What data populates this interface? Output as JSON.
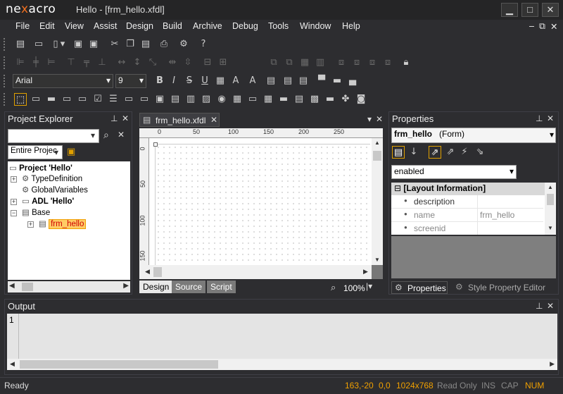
{
  "app": {
    "logo_a": "ne",
    "logo_x": "x",
    "logo_b": "acro",
    "window_title": "Hello - [frm_hello.xfdl]",
    "min": "▁",
    "max": "□",
    "close": "✕"
  },
  "menu": [
    "File",
    "Edit",
    "View",
    "Assist",
    "Design",
    "Build",
    "Archive",
    "Debug",
    "Tools",
    "Window",
    "Help"
  ],
  "mdi_controls": {
    "min": "–",
    "restore": "⧉",
    "close": "✕"
  },
  "font": {
    "family": "Arial",
    "size": "9"
  },
  "format_buttons": {
    "bold": "B",
    "italic": "I",
    "strike": "S",
    "underline": "U"
  },
  "project_explorer": {
    "title": "Project Explorer",
    "search_value": "",
    "scope": "Entire Projec",
    "tree": [
      {
        "label": "Project 'Hello'",
        "bold": true
      },
      {
        "label": "TypeDefinition"
      },
      {
        "label": "GlobalVariables"
      },
      {
        "label": "ADL 'Hello'",
        "bold": true
      },
      {
        "label": "Base"
      },
      {
        "label": "frm_hello",
        "selected": true
      }
    ]
  },
  "editor": {
    "tab": "frm_hello.xfdl",
    "ruler_h": [
      "0",
      "50",
      "100",
      "150",
      "200",
      "250"
    ],
    "ruler_v": [
      "0",
      "50",
      "100",
      "150"
    ],
    "bottom_tabs": [
      "Design",
      "Source",
      "Script"
    ],
    "zoom": "100%"
  },
  "properties": {
    "title": "Properties",
    "object_name": "frm_hello",
    "object_type": "(Form)",
    "filter": "enabled",
    "section": "[Layout Information]",
    "rows": [
      {
        "name": "description",
        "value": ""
      },
      {
        "name": "name",
        "value": "frm_hello"
      },
      {
        "name": "screenid",
        "value": ""
      }
    ],
    "tabs": [
      "Properties",
      "Style Property Editor"
    ]
  },
  "output": {
    "title": "Output",
    "line_no": "1"
  },
  "status": {
    "left": "Ready",
    "coords": "163,-20",
    "pos": "0,0",
    "resolution": "1024x768",
    "readonly": "Read Only",
    "ins": "INS",
    "cap": "CAP",
    "num": "NUM"
  }
}
